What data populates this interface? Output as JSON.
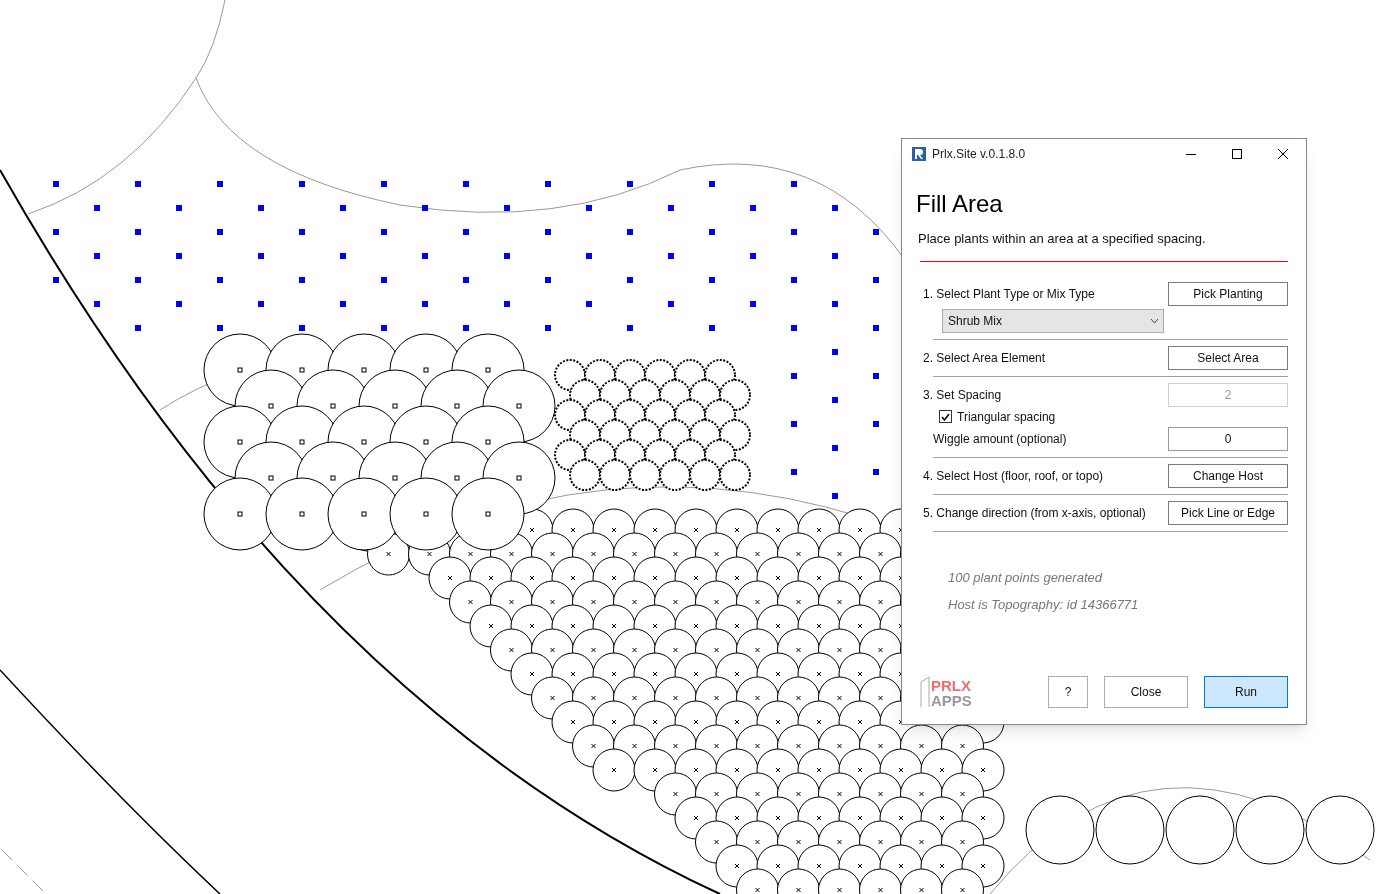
{
  "window": {
    "title": "Prlx.Site v.0.1.8.0"
  },
  "heading": "Fill Area",
  "description": "Place plants within an area at a specified spacing.",
  "steps": [
    {
      "label": "1. Select Plant Type or Mix Type",
      "button": "Pick Planting",
      "dropdown": {
        "value": "Shrub Mix"
      }
    },
    {
      "label": "2. Select Area Element",
      "button": "Select Area"
    },
    {
      "label": "3. Set Spacing",
      "field": {
        "value": "2",
        "disabled": true
      },
      "options": [
        {
          "kind": "checkbox",
          "label": "Triangular spacing",
          "checked": true
        },
        {
          "kind": "field",
          "label": "Wiggle amount (optional)",
          "value": "0",
          "disabled": false
        }
      ]
    },
    {
      "label": "4. Select Host (floor, roof, or topo)",
      "button": "Change Host"
    },
    {
      "label": "5. Change direction (from x-axis, optional)",
      "button": "Pick Line or Edge"
    }
  ],
  "status": [
    "100 plant points generated",
    "Host is Topography: id 14366771"
  ],
  "logo": {
    "line_1": "PRLX",
    "line_2": "APPS"
  },
  "buttons": [
    {
      "label": "?",
      "default": false
    },
    {
      "label": "Close",
      "default": false
    },
    {
      "label": "Run",
      "default": true
    }
  ]
}
